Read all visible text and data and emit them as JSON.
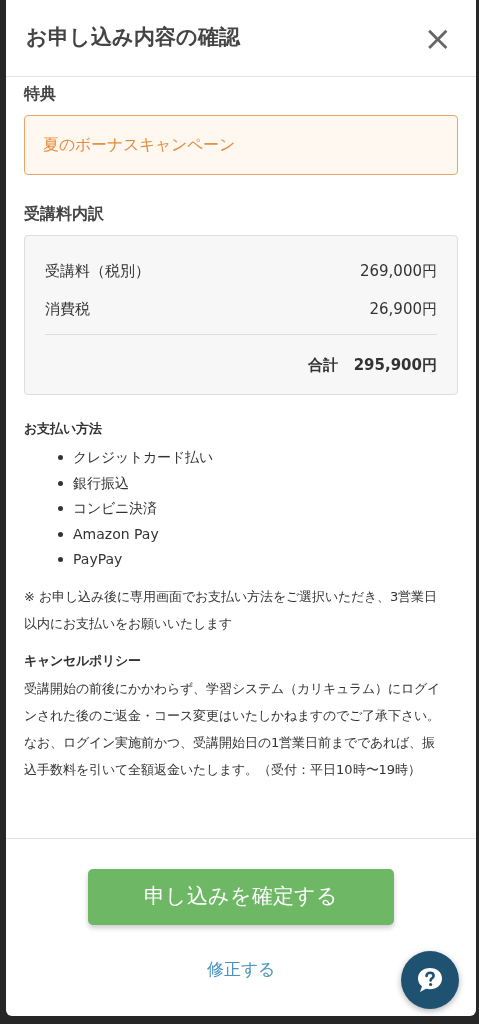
{
  "modal": {
    "title": "お申し込み内容の確認",
    "close": "×"
  },
  "benefit": {
    "heading": "特典",
    "label": "夏のボーナスキャンペーン"
  },
  "fee": {
    "heading": "受講料内訳",
    "rows": [
      {
        "label": "受講料（税別）",
        "value": "269,000円"
      },
      {
        "label": "消費税",
        "value": "26,900円"
      }
    ],
    "total": {
      "label": "合計",
      "value": "295,900円"
    }
  },
  "payment": {
    "heading": "お支払い方法",
    "methods": [
      "クレジットカード払い",
      "銀行振込",
      "コンビニ決済",
      "Amazon Pay",
      "PayPay"
    ]
  },
  "note": "※ お申し込み後に専用画面でお支払い方法をご選択いただき、3営業日以内にお支払いをお願いいたします",
  "cancel": {
    "heading": "キャンセルポリシー",
    "text": "受講開始の前後にかかわらず、学習システム（カリキュラム）にログインされた後のご返金・コース変更はいたしかねますのでご了承下さい。なお、ログイン実施前かつ、受講開始日の1営業日前までであれば、振込手数料を引いて全額返金いたします。（受付：平日10時〜19時）"
  },
  "confirm_button": "申し込みを確定する",
  "edit_link": "修正する"
}
